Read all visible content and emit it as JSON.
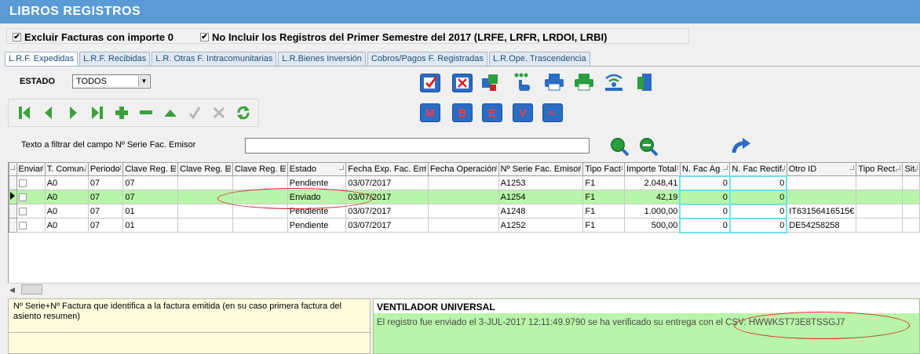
{
  "app": {
    "title": "LIBROS REGISTROS"
  },
  "options": {
    "excluir_label": "Excluir Facturas con importe 0",
    "no_incluir_label": "No Incluir los Registros del Primer Semestre del 2017 (LRFE, LRFR, LRDOI, LRBI)"
  },
  "tabs": [
    {
      "label": "L.R.F. Expedidas"
    },
    {
      "label": "L.R.F. Recibidas"
    },
    {
      "label": "L.R. Otras F. Intracomunitarias"
    },
    {
      "label": "L.R.Bienes Inversión"
    },
    {
      "label": "Cobros/Pagos F. Registradas"
    },
    {
      "label": "L.R.Ope. Trascendencia"
    }
  ],
  "estado": {
    "label": "ESTADO",
    "value": "TODOS"
  },
  "action_letters": {
    "m": "M",
    "b": "B",
    "e": "E",
    "v": "V",
    "back": "<-"
  },
  "filter": {
    "label": "Texto a filtrar del campo Nº Serie Fac. Emisor",
    "value": ""
  },
  "grid": {
    "columns": [
      "Enviar",
      "T. Comun.",
      "Periodo",
      "Clave Reg. E",
      "Clave Reg. E",
      "Clave Reg. E",
      "Estado",
      "Fecha Exp. Fac. Em",
      "Fecha Operación",
      "Nº Serie Fac. Emisor",
      "Tipo Fact",
      "Importe Total",
      "N. Fac Ag",
      "N. Fac Rectif.",
      "Otro ID",
      "Tipo Rect.",
      "Sit."
    ],
    "rows": [
      {
        "t_comun": "A0",
        "periodo": "07",
        "clave1": "07",
        "clave2": "",
        "clave3": "",
        "estado": "Pendiente",
        "fecha_exp": "03/07/2017",
        "fecha_op": "",
        "serie": "A1253",
        "tipo": "F1",
        "importe": "2.048,41",
        "n_fac_ag": "0",
        "n_fac_rect": "0",
        "otro_id": "",
        "tipo_rect": "",
        "sit": ""
      },
      {
        "t_comun": "A0",
        "periodo": "07",
        "clave1": "07",
        "clave2": "",
        "clave3": "",
        "estado": "Enviado",
        "fecha_exp": "03/07/2017",
        "fecha_op": "",
        "serie": "A1254",
        "tipo": "F1",
        "importe": "42,19",
        "n_fac_ag": "0",
        "n_fac_rect": "0",
        "otro_id": "",
        "tipo_rect": "",
        "sit": ""
      },
      {
        "t_comun": "A0",
        "periodo": "07",
        "clave1": "01",
        "clave2": "",
        "clave3": "",
        "estado": "Pendiente",
        "fecha_exp": "03/07/2017",
        "fecha_op": "",
        "serie": "A1248",
        "tipo": "F1",
        "importe": "1.000,00",
        "n_fac_ag": "0",
        "n_fac_rect": "0",
        "otro_id": "IT63156416515€",
        "tipo_rect": "",
        "sit": ""
      },
      {
        "t_comun": "A0",
        "periodo": "07",
        "clave1": "01",
        "clave2": "",
        "clave3": "",
        "estado": "Pendiente",
        "fecha_exp": "03/07/2017",
        "fecha_op": "",
        "serie": "A1252",
        "tipo": "F1",
        "importe": "500,00",
        "n_fac_ag": "0",
        "n_fac_rect": "0",
        "otro_id": "DE54258258",
        "tipo_rect": "",
        "sit": ""
      }
    ]
  },
  "description": {
    "text": "Nº Serie+Nº Factura que identifica a la factura emitida (en su caso primera factura del asiento resumen)"
  },
  "status": {
    "title": "VENTILADOR UNIVERSAL",
    "message": "El registro fue enviado el 3-JUL-2017 12:11:49.9790 se ha verificado su entrega con el CSV: HWWKST73E8TSSGJ7"
  }
}
